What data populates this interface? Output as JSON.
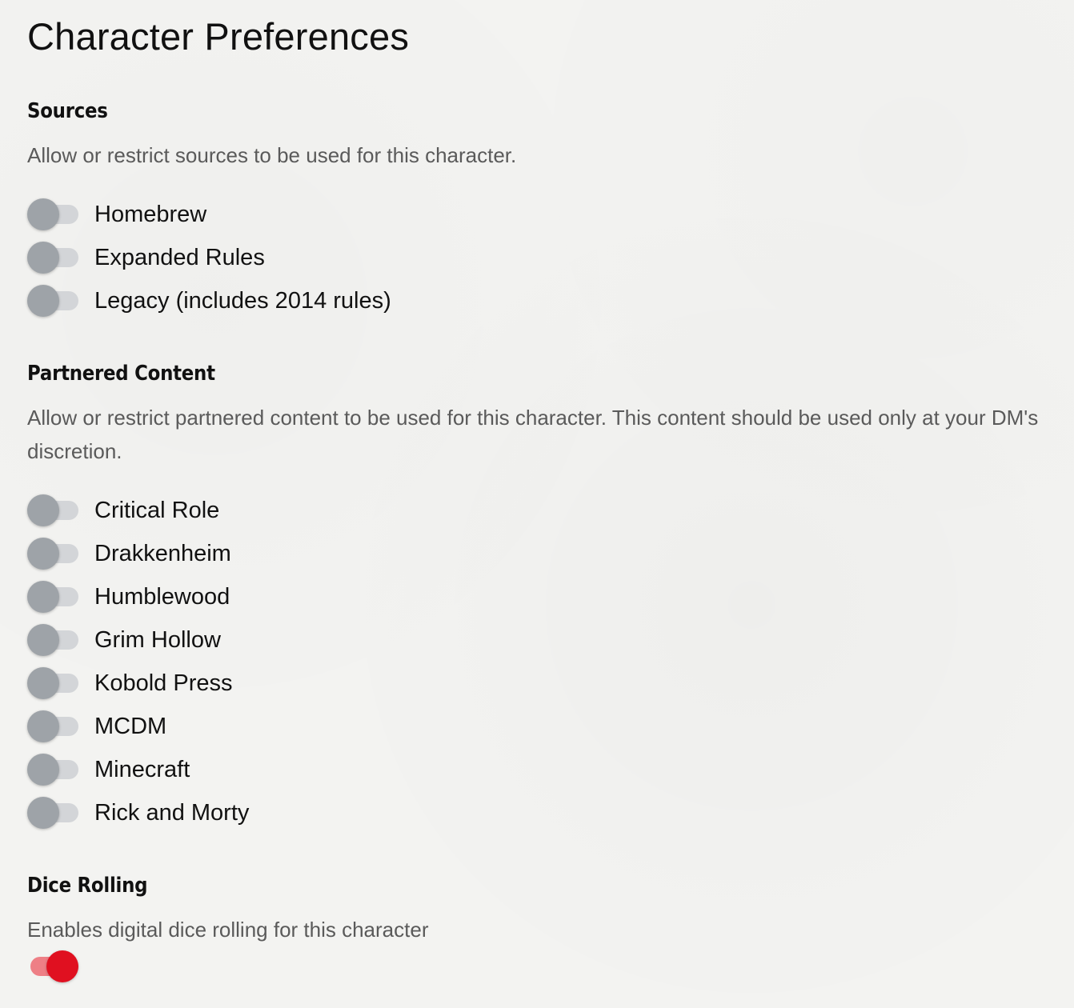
{
  "page": {
    "title": "Character Preferences"
  },
  "sources": {
    "heading": "Sources",
    "description": "Allow or restrict sources to be used for this character.",
    "toggles": [
      {
        "label": "Homebrew",
        "enabled": false
      },
      {
        "label": "Expanded Rules",
        "enabled": false
      },
      {
        "label": "Legacy (includes 2014 rules)",
        "enabled": false
      }
    ]
  },
  "partnered": {
    "heading": "Partnered Content",
    "description": "Allow or restrict partnered content to be used for this character. This content should be used only at your DM's discretion.",
    "toggles": [
      {
        "label": "Critical Role",
        "enabled": false
      },
      {
        "label": "Drakkenheim",
        "enabled": false
      },
      {
        "label": "Humblewood",
        "enabled": false
      },
      {
        "label": "Grim Hollow",
        "enabled": false
      },
      {
        "label": "Kobold Press",
        "enabled": false
      },
      {
        "label": "MCDM",
        "enabled": false
      },
      {
        "label": "Minecraft",
        "enabled": false
      },
      {
        "label": "Rick and Morty",
        "enabled": false
      }
    ]
  },
  "dice": {
    "heading": "Dice Rolling",
    "description": "Enables digital dice rolling for this character",
    "enabled": true
  },
  "colors": {
    "toggle_off_track": "#d3d5d8",
    "toggle_off_knob": "#9ea3a8",
    "toggle_on_track": "#ee7f86",
    "toggle_on_knob": "#e01020"
  }
}
